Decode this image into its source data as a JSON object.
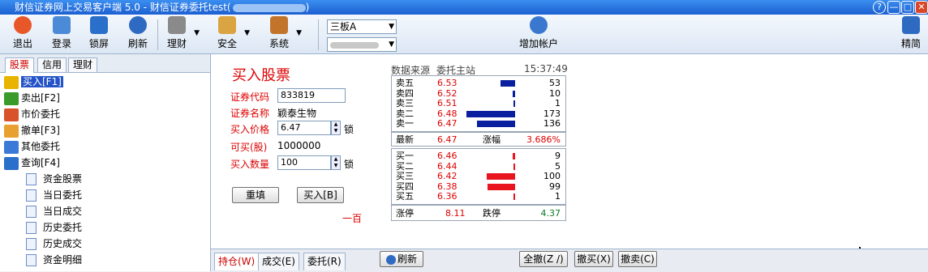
{
  "window": {
    "title": "财信证券网上交易客户端 5.0 - 财信证券委托test(",
    "title_suffix": ")",
    "help": "?",
    "minimize": "—",
    "maximize": "□",
    "close": "✕"
  },
  "toolbar": {
    "items": [
      {
        "label": "退出",
        "icon": "exit-icon",
        "color": "#e8572a"
      },
      {
        "label": "登录",
        "icon": "users-icon",
        "color": "#4b8ad6"
      },
      {
        "label": "锁屏",
        "icon": "lock-screen-icon",
        "color": "#2a6fc9"
      },
      {
        "label": "刷新",
        "icon": "refresh-icon",
        "color": "#2f6ac2"
      },
      {
        "label": "理财",
        "icon": "finance-icon",
        "color": "#8a8a8a"
      },
      {
        "label": "安全",
        "icon": "key-icon",
        "color": "#d9a441"
      },
      {
        "label": "系统",
        "icon": "tools-icon",
        "color": "#c2742b"
      }
    ],
    "market_select": "三板A",
    "account_select": "",
    "add_account": "增加帐户",
    "compact": "精简",
    "dropdown_glyph": "▼"
  },
  "left_tabs": [
    "股票",
    "信用",
    "理财"
  ],
  "tree": {
    "top_items": [
      {
        "label": "买入[F1]",
        "icon": "buy-icon",
        "color": "#e8b400"
      },
      {
        "label": "卖出[F2]",
        "icon": "sell-icon",
        "color": "#3a9a2a"
      },
      {
        "label": "市价委托",
        "icon": "market-order-icon",
        "color": "#d9532a"
      },
      {
        "label": "撤单[F3]",
        "icon": "cancel-order-icon",
        "color": "#e8a030"
      },
      {
        "label": "其他委托",
        "icon": "other-order-icon",
        "color": "#3a7ad6"
      },
      {
        "label": "查询[F4]",
        "icon": "query-icon",
        "color": "#2a6fc9"
      }
    ],
    "sub_items": [
      "资金股票",
      "当日委托",
      "当日成交",
      "历史委托",
      "历史成交",
      "资金明细"
    ]
  },
  "form": {
    "title": "买入股票",
    "code_label": "证券代码",
    "code_value": "833819",
    "name_label": "证券名称",
    "name_value": "颖泰生物",
    "price_label": "买入价格",
    "price_value": "6.47",
    "available_label": "可买(股)",
    "available_value": "1000000",
    "qty_label": "买入数量",
    "qty_value": "100",
    "lock": "锁",
    "reset_btn": "重填",
    "buy_btn": "买入[B]",
    "unit_hint": "一百"
  },
  "quote": {
    "source_label": "数据来源",
    "source_value": "委托主站",
    "time": "15:37:49",
    "sell": [
      {
        "name": "卖五",
        "price": "6.53",
        "vol": "53",
        "volnum": 53
      },
      {
        "name": "卖四",
        "price": "6.52",
        "vol": "10",
        "volnum": 10
      },
      {
        "name": "卖三",
        "price": "6.51",
        "vol": "1",
        "volnum": 1
      },
      {
        "name": "卖二",
        "price": "6.48",
        "vol": "173",
        "volnum": 173
      },
      {
        "name": "卖一",
        "price": "6.47",
        "vol": "136",
        "volnum": 136
      }
    ],
    "latest_label": "最新",
    "latest_value": "6.47",
    "change_label": "涨幅",
    "change_value": "3.686%",
    "buy": [
      {
        "name": "买一",
        "price": "6.46",
        "vol": "9",
        "volnum": 9
      },
      {
        "name": "买二",
        "price": "6.44",
        "vol": "5",
        "volnum": 5
      },
      {
        "name": "买三",
        "price": "6.42",
        "vol": "100",
        "volnum": 100
      },
      {
        "name": "买四",
        "price": "6.38",
        "vol": "99",
        "volnum": 99
      },
      {
        "name": "买五",
        "price": "6.36",
        "vol": "1",
        "volnum": 1
      }
    ],
    "limit_up_label": "涨停",
    "limit_up_value": "8.11",
    "limit_down_label": "跌停",
    "limit_down_value": "4.37",
    "sell_bar_color": "#0a1fa0",
    "buy_bar_color": "#e8141e"
  },
  "bottom": {
    "tabs": [
      "持仓(W)",
      "成交(E)",
      "委托(R)"
    ],
    "refresh": "刷新",
    "cancel_all": "全撤(Z /)",
    "cancel_buy": "撤买(X)",
    "cancel_sell": "撤卖(C)"
  }
}
